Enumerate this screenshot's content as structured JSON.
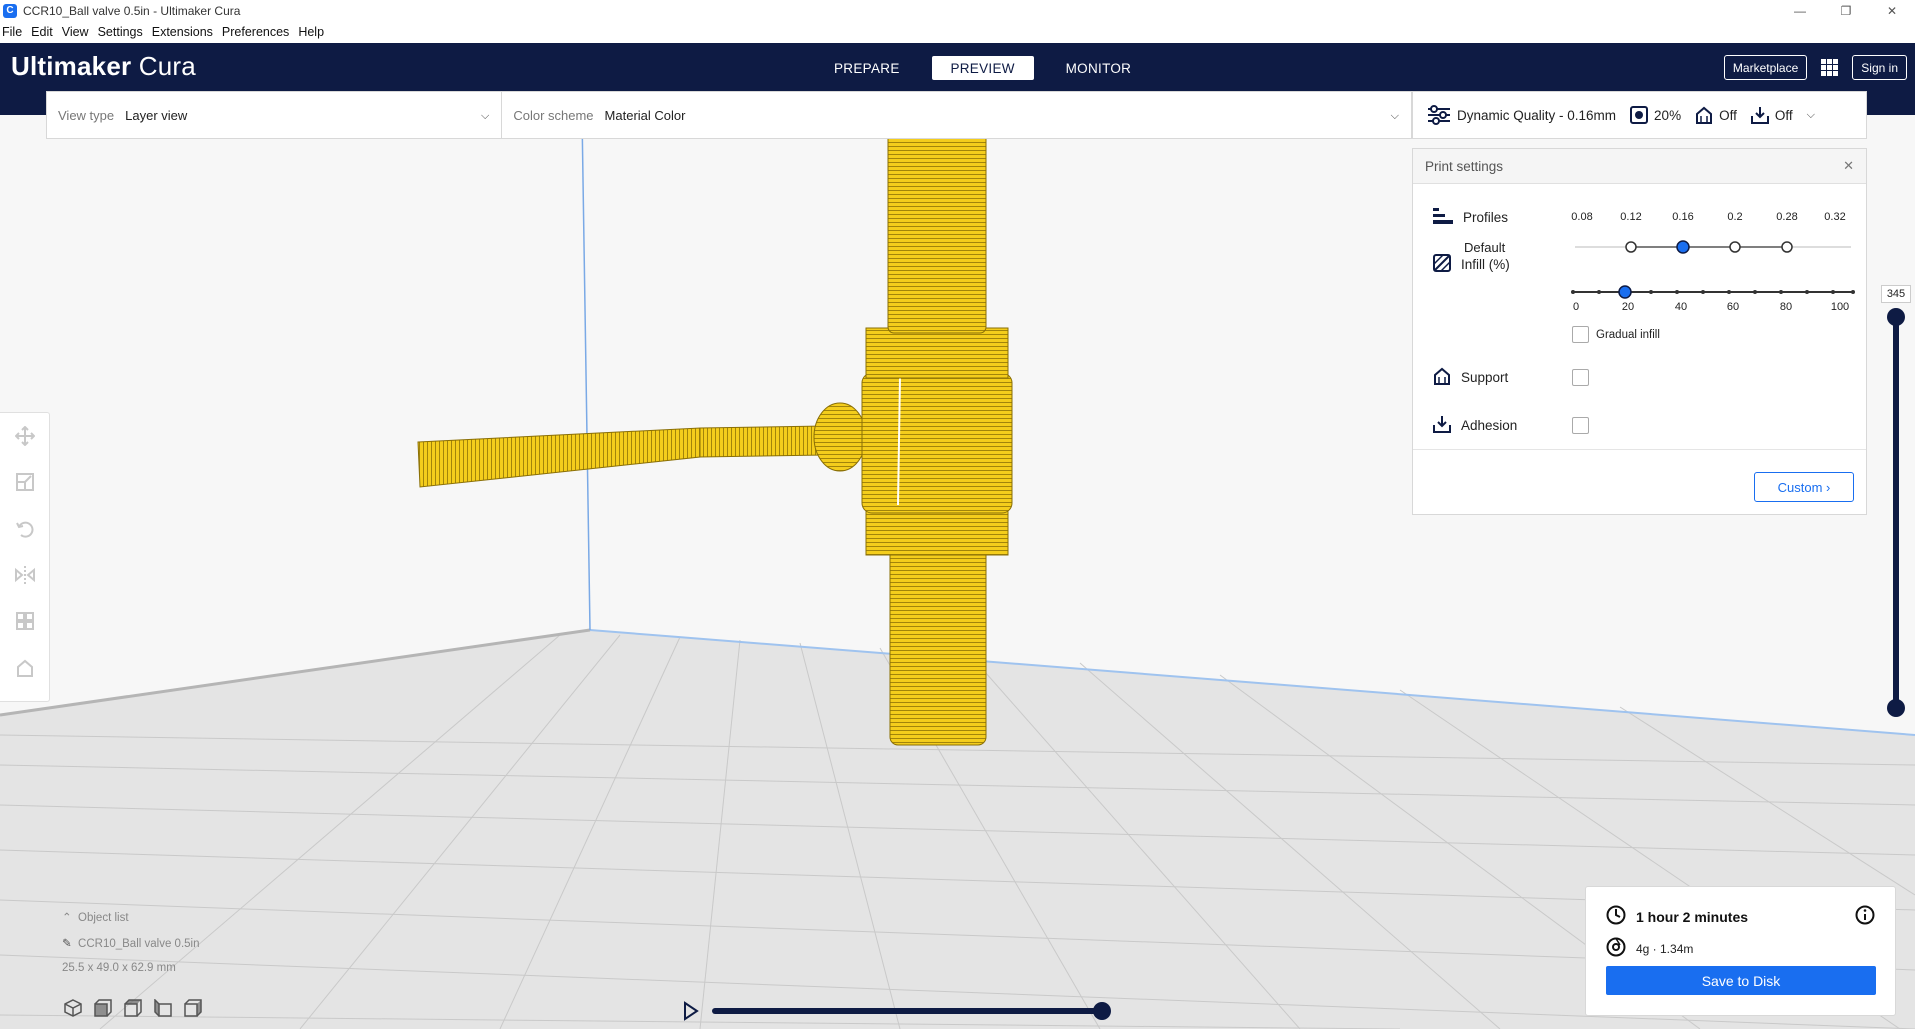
{
  "window": {
    "title": "CCR10_Ball valve 0.5in - Ultimaker Cura",
    "app_icon_letter": "C"
  },
  "menu": [
    "File",
    "Edit",
    "View",
    "Settings",
    "Extensions",
    "Preferences",
    "Help"
  ],
  "header": {
    "logo_bold": "Ultimaker",
    "logo_rest": " Cura",
    "stages": [
      "PREPARE",
      "PREVIEW",
      "MONITOR"
    ],
    "active_stage": "PREVIEW",
    "marketplace": "Marketplace",
    "sign_in": "Sign in"
  },
  "viewbar": {
    "view_type_label": "View type",
    "view_type_value": "Layer view",
    "color_scheme_label": "Color scheme",
    "color_scheme_value": "Material Color"
  },
  "setupbar": {
    "profile": "Dynamic Quality - 0.16mm",
    "infill": "20%",
    "support": "Off",
    "adhesion": "Off"
  },
  "print_settings": {
    "title": "Print settings",
    "profiles_label": "Profiles",
    "profile_ticks": [
      "0.08",
      "0.12",
      "0.16",
      "0.2",
      "0.28",
      "0.32"
    ],
    "default_label": "Default",
    "selected_profile": "0.16",
    "infill_label": "Infill (%)",
    "infill_ticks": [
      "0",
      "20",
      "40",
      "60",
      "80",
      "100"
    ],
    "infill_value": 20,
    "gradual_infill": "Gradual infill",
    "support_label": "Support",
    "adhesion_label": "Adhesion",
    "custom_button": "Custom"
  },
  "layer_slider": {
    "value": "345"
  },
  "object_list": {
    "header": "Object list",
    "item": "CCR10_Ball valve 0.5in",
    "dimensions": "25.5 x 49.0 x 62.9 mm"
  },
  "job": {
    "time": "1 hour 2 minutes",
    "material": "4g · 1.34m",
    "save_button": "Save to Disk"
  },
  "colors": {
    "header_bg": "#0e1b44",
    "accent": "#196ef0",
    "model_yellow": "#f2c613"
  }
}
